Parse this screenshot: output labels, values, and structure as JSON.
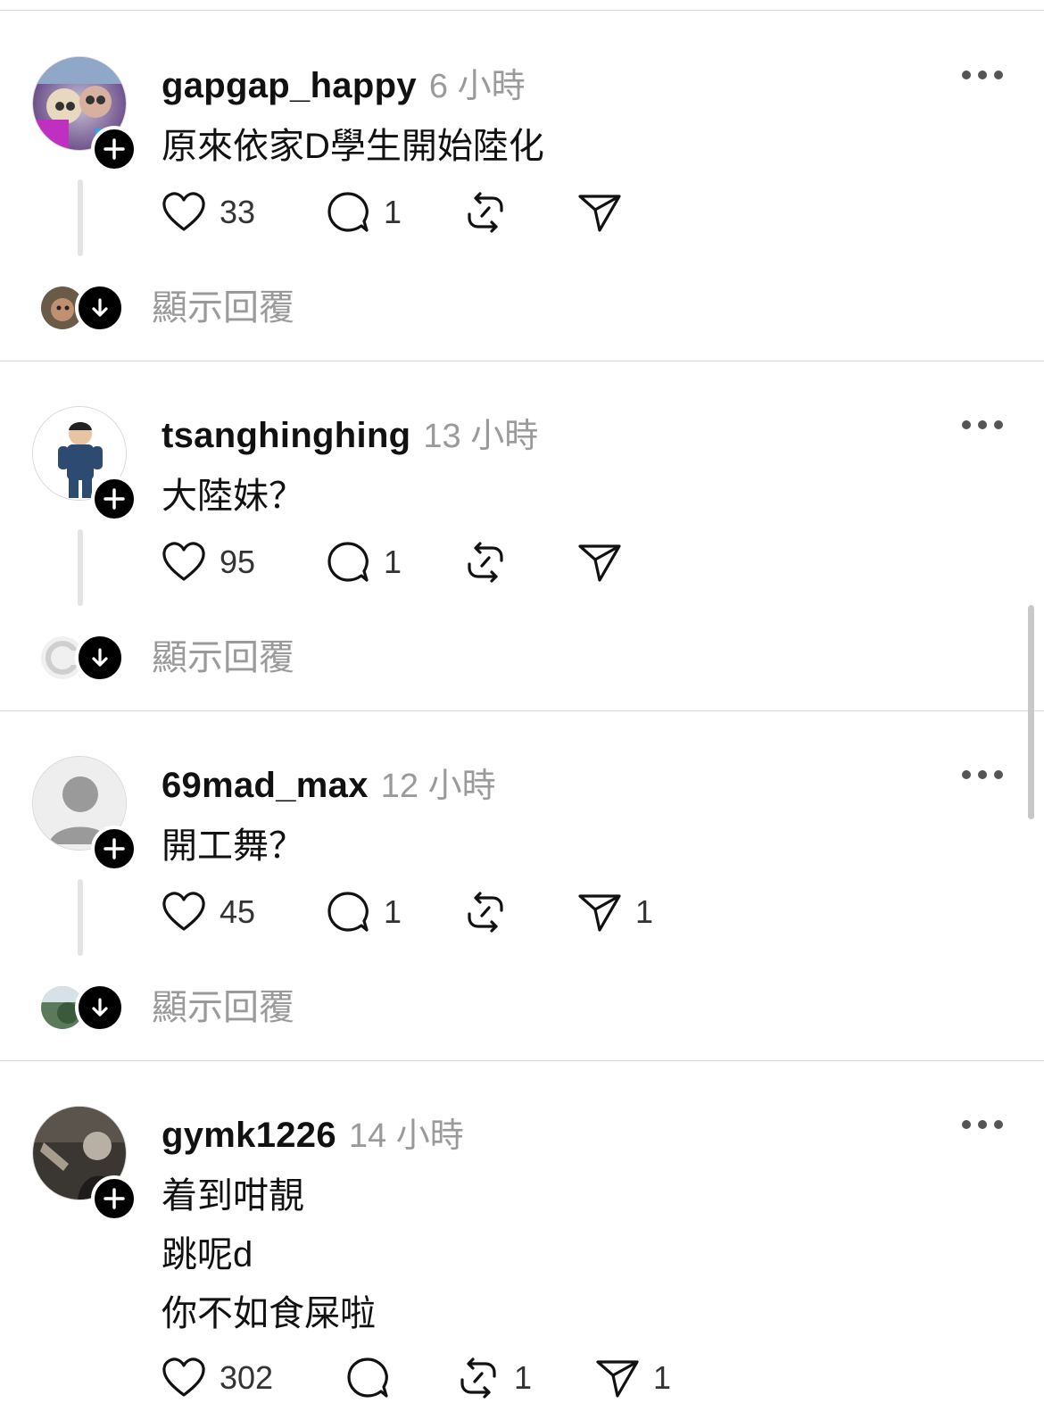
{
  "posts": [
    {
      "username": "gapgap_happy",
      "time": "6 小時",
      "lines": [
        "原來依家D學生開始陸化"
      ],
      "likes": "33",
      "comments": "1",
      "reposts": "",
      "shares": "",
      "show_replies": "顯示回覆"
    },
    {
      "username": "tsanghinghing",
      "time": "13 小時",
      "lines": [
        "大陸妹？"
      ],
      "likes": "95",
      "comments": "1",
      "reposts": "",
      "shares": "",
      "show_replies": "顯示回覆"
    },
    {
      "username": "69mad_max",
      "time": "12 小時",
      "lines": [
        "開工舞？"
      ],
      "likes": "45",
      "comments": "1",
      "reposts": "",
      "shares": "1",
      "show_replies": "顯示回覆"
    },
    {
      "username": "gymk1226",
      "time": "14 小時",
      "lines": [
        "着到咁靚",
        "跳呢d",
        "你不如食屎啦"
      ],
      "likes": "302",
      "comments": "",
      "reposts": "1",
      "shares": "1"
    }
  ],
  "icons": {
    "like": "heart-icon",
    "comment": "comment-bubble-icon",
    "repost": "repost-icon",
    "share": "send-icon",
    "more": "more-dots-icon",
    "follow": "plus-icon",
    "expand": "arrow-down-icon"
  },
  "colors": {
    "text": "#111111",
    "secondary": "#9a9a9a",
    "badge": "#000000",
    "divider": "#dcdcdc"
  }
}
